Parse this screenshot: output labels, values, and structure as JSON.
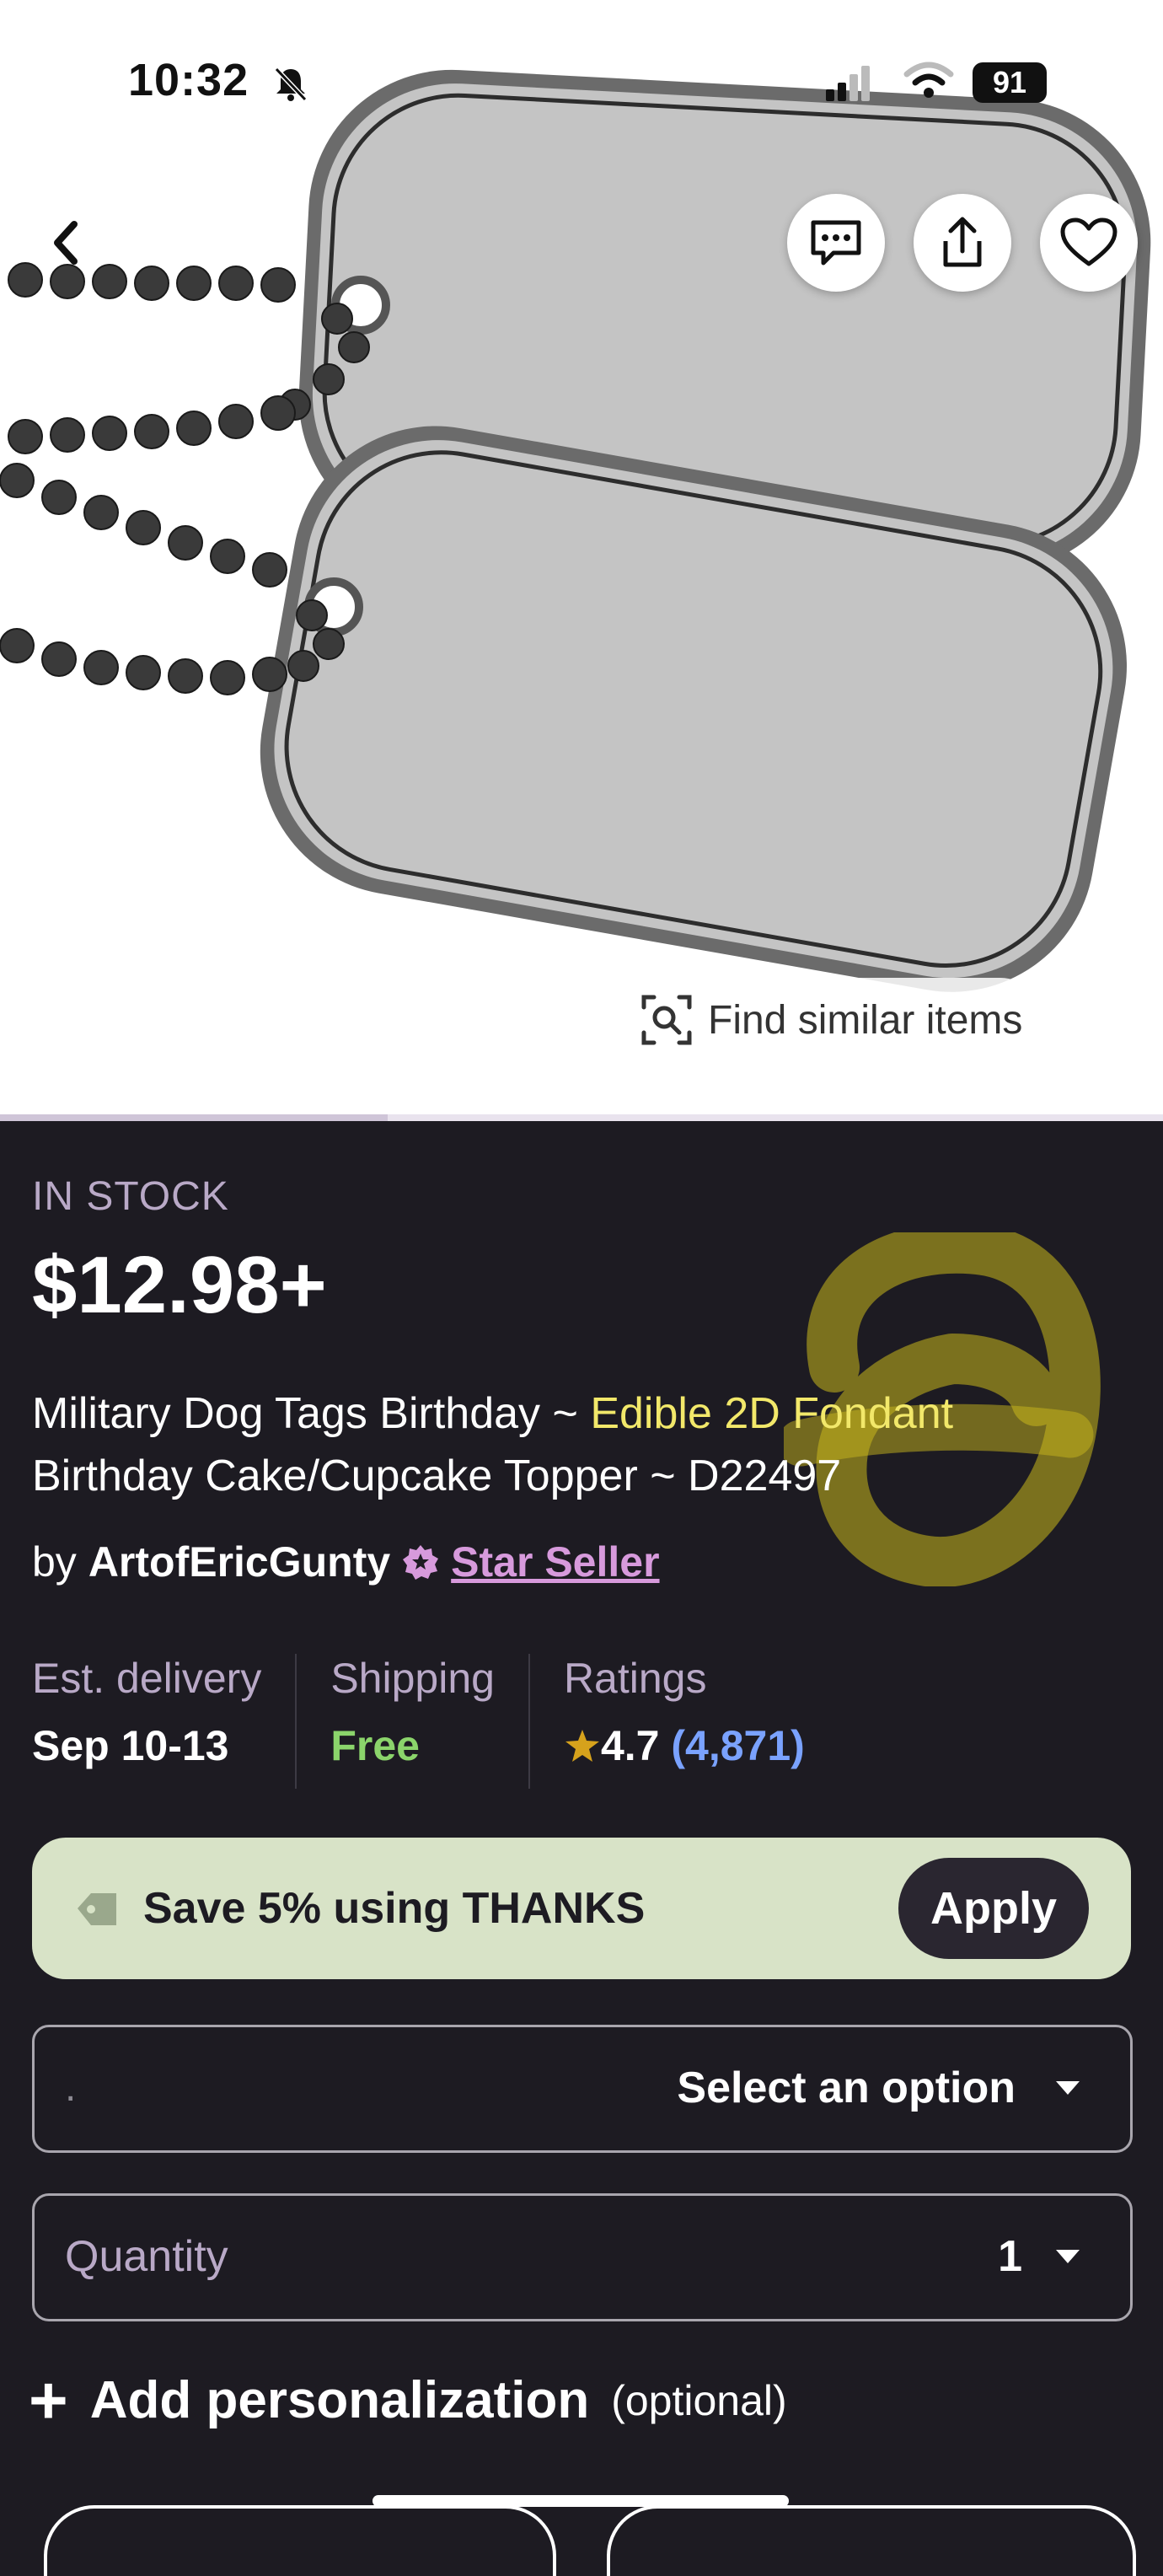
{
  "status_bar": {
    "time": "10:32",
    "battery": "91"
  },
  "hero": {
    "find_similar": "Find similar items"
  },
  "product": {
    "stock": "IN STOCK",
    "price": "$12.98+",
    "title_part1": "Military Dog Tags Birthday ~ ",
    "title_highlight": "Edible 2D Fondant",
    "title_part2": "Birthday Cake/Cupcake Topper ~ D22497",
    "by": "by",
    "seller": "ArtofEricGunty",
    "badge": "Star Seller"
  },
  "info": {
    "delivery_label": "Est. delivery",
    "delivery_value": "Sep 10-13",
    "shipping_label": "Shipping",
    "shipping_value": "Free",
    "ratings_label": "Ratings",
    "rating": "4.7",
    "rating_count": "(4,871)"
  },
  "coupon": {
    "text": "Save 5% using THANKS",
    "apply": "Apply"
  },
  "option_select": {
    "placeholder": ".",
    "value": "Select an option"
  },
  "quantity": {
    "label": "Quantity",
    "value": "1"
  },
  "personalization": {
    "label": "Add personalization",
    "optional": "(optional)"
  },
  "colors": {
    "background": "#1d1b22",
    "accent_purple": "#d79adc",
    "highlight_yellow": "#f2e86a",
    "free_green": "#8bd46b",
    "count_blue": "#7aa2ff",
    "coupon_bg": "#d8e3c7",
    "star": "#d6a21c"
  }
}
